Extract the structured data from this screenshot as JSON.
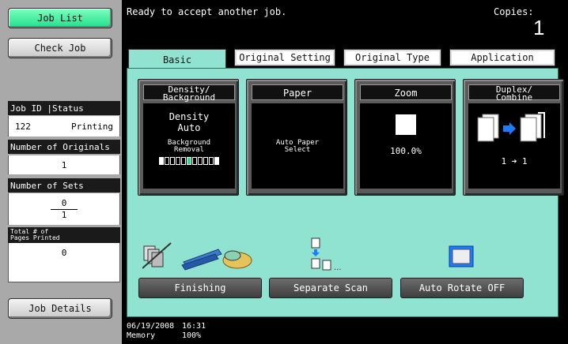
{
  "left": {
    "job_list": "Job List",
    "check_job": "Check Job",
    "job_id_status_header": "Job ID |Status",
    "job_id": "122",
    "job_status": "Printing",
    "num_originals_label": "Number of Originals",
    "num_originals_value": "1",
    "num_sets_label": "Number of Sets",
    "sets_done": "0",
    "sets_total": "1",
    "total_printed_label_line1": "Total # of",
    "total_printed_label_line2": "Pages Printed",
    "total_printed_value": "0",
    "job_details": "Job Details"
  },
  "top": {
    "status_message": "Ready to accept another job.",
    "copies_label": "Copies:",
    "copies_value": "1"
  },
  "tabs": [
    "Basic",
    "Original Setting",
    "Original Type",
    "Application"
  ],
  "cards": {
    "density": {
      "title_line1": "Density/",
      "title_line2": "Background",
      "value_line1": "Density",
      "value_line2": "Auto",
      "sub_line1": "Background",
      "sub_line2": "Removal"
    },
    "paper": {
      "title": "Paper",
      "value_line1": "Auto Paper",
      "value_line2": "Select"
    },
    "zoom": {
      "title": "Zoom",
      "value": "100.0%"
    },
    "duplex": {
      "title_line1": "Duplex/",
      "title_line2": "Combine",
      "value": "1 ➜ 1"
    }
  },
  "bottom_buttons": {
    "finishing": "Finishing",
    "separate_scan": "Separate Scan",
    "auto_rotate": "Auto Rotate OFF"
  },
  "status_bar": {
    "date": "06/19/2008",
    "time": "16:31",
    "memory_label": "Memory",
    "memory_value": "100%"
  },
  "colors": {
    "panel": "#8fe3d0",
    "active_button": "#21e08a",
    "accent_blue": "#1e7bff"
  }
}
